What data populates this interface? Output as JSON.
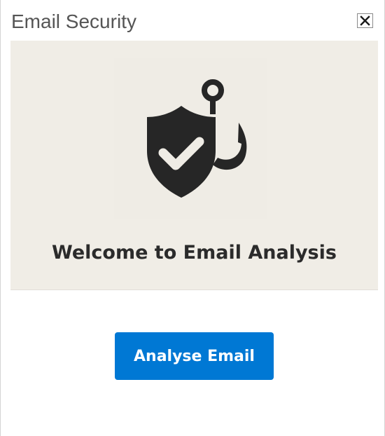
{
  "pane": {
    "title": "Email Security",
    "close_label": "Close"
  },
  "hero": {
    "icon": "shield-check-phishing-hook-icon",
    "heading": "Welcome to Email Analysis"
  },
  "actions": {
    "analyse_label": "Analyse Email"
  },
  "colors": {
    "accent": "#0078d4",
    "hero_background": "#f0ede6",
    "icon": "#262626",
    "title": "#555555"
  }
}
